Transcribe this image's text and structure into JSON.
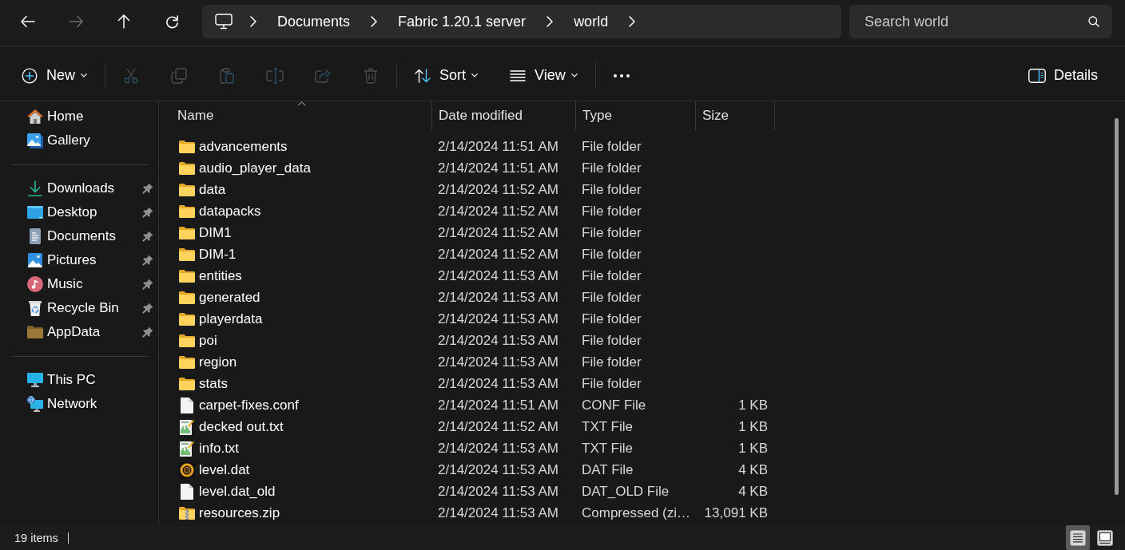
{
  "nav": [
    {
      "kind": "back",
      "disabled": false
    },
    {
      "kind": "forward",
      "disabled": true
    },
    {
      "kind": "up",
      "disabled": false
    },
    {
      "kind": "refresh",
      "disabled": false
    }
  ],
  "address_bar": {
    "crumbs": [
      "Documents",
      "Fabric 1.20.1 server",
      "world"
    ]
  },
  "search": {
    "placeholder": "Search world"
  },
  "toolbar": {
    "groups": [
      [
        {
          "kind": "new",
          "label": "New",
          "dropdown": true,
          "disabled": false
        }
      ],
      [
        {
          "kind": "cut",
          "dropdown": false,
          "disabled": true
        },
        {
          "kind": "copy",
          "dropdown": false,
          "disabled": true
        },
        {
          "kind": "paste",
          "dropdown": false,
          "disabled": true
        },
        {
          "kind": "rename",
          "dropdown": false,
          "disabled": true
        },
        {
          "kind": "share",
          "dropdown": false,
          "disabled": true
        },
        {
          "kind": "delete",
          "dropdown": false,
          "disabled": true
        }
      ],
      [
        {
          "kind": "sort",
          "label": "Sort",
          "dropdown": true,
          "disabled": false
        },
        {
          "kind": "view",
          "label": "View",
          "dropdown": true,
          "disabled": false
        }
      ],
      [
        {
          "kind": "more",
          "dropdown": false,
          "disabled": false
        }
      ]
    ],
    "details": {
      "label": "Details"
    }
  },
  "sidebar": {
    "sections": [
      {
        "items": [
          {
            "label": "Home",
            "kind": "home",
            "pinned": false
          },
          {
            "label": "Gallery",
            "kind": "gallery",
            "pinned": false
          }
        ]
      },
      {
        "items": [
          {
            "label": "Downloads",
            "kind": "downloads",
            "pinned": true
          },
          {
            "label": "Desktop",
            "kind": "desktop",
            "pinned": true
          },
          {
            "label": "Documents",
            "kind": "documents",
            "pinned": true
          },
          {
            "label": "Pictures",
            "kind": "pictures",
            "pinned": true
          },
          {
            "label": "Music",
            "kind": "music",
            "pinned": true
          },
          {
            "label": "Recycle Bin",
            "kind": "recycle-bin",
            "pinned": true
          },
          {
            "label": "AppData",
            "kind": "folder",
            "pinned": true
          }
        ]
      },
      {
        "items": [
          {
            "label": "This PC",
            "kind": "this-pc",
            "pinned": false
          },
          {
            "label": "Network",
            "kind": "network",
            "pinned": false
          }
        ]
      }
    ]
  },
  "table": {
    "columns": [
      {
        "label": "Name",
        "sorted": true
      },
      {
        "label": "Date modified",
        "sorted": false
      },
      {
        "label": "Type",
        "sorted": false
      },
      {
        "label": "Size",
        "sorted": false
      }
    ],
    "rows": [
      {
        "kind": "folder",
        "name": "advancements",
        "date": "2/14/2024 11:51 AM",
        "type": "File folder"
      },
      {
        "kind": "folder",
        "name": "audio_player_data",
        "date": "2/14/2024 11:51 AM",
        "type": "File folder"
      },
      {
        "kind": "folder",
        "name": "data",
        "date": "2/14/2024 11:52 AM",
        "type": "File folder"
      },
      {
        "kind": "folder",
        "name": "datapacks",
        "date": "2/14/2024 11:52 AM",
        "type": "File folder"
      },
      {
        "kind": "folder",
        "name": "DIM1",
        "date": "2/14/2024 11:52 AM",
        "type": "File folder"
      },
      {
        "kind": "folder",
        "name": "DIM-1",
        "date": "2/14/2024 11:52 AM",
        "type": "File folder"
      },
      {
        "kind": "folder",
        "name": "entities",
        "date": "2/14/2024 11:53 AM",
        "type": "File folder"
      },
      {
        "kind": "folder",
        "name": "generated",
        "date": "2/14/2024 11:53 AM",
        "type": "File folder"
      },
      {
        "kind": "folder",
        "name": "playerdata",
        "date": "2/14/2024 11:53 AM",
        "type": "File folder"
      },
      {
        "kind": "folder",
        "name": "poi",
        "date": "2/14/2024 11:53 AM",
        "type": "File folder"
      },
      {
        "kind": "folder",
        "name": "region",
        "date": "2/14/2024 11:53 AM",
        "type": "File folder"
      },
      {
        "kind": "folder",
        "name": "stats",
        "date": "2/14/2024 11:53 AM",
        "type": "File folder"
      },
      {
        "kind": "file",
        "name": "carpet-fixes.conf",
        "date": "2/14/2024 11:51 AM",
        "type": "CONF File",
        "size": "1 KB"
      },
      {
        "kind": "text",
        "name": "decked out.txt",
        "date": "2/14/2024 11:52 AM",
        "type": "TXT File",
        "size": "1 KB"
      },
      {
        "kind": "text",
        "name": "info.txt",
        "date": "2/14/2024 11:53 AM",
        "type": "TXT File",
        "size": "1 KB"
      },
      {
        "kind": "app",
        "name": "level.dat",
        "date": "2/14/2024 11:53 AM",
        "type": "DAT File",
        "size": "4 KB"
      },
      {
        "kind": "file",
        "name": "level.dat_old",
        "date": "2/14/2024 11:53 AM",
        "type": "DAT_OLD File",
        "size": "4 KB"
      },
      {
        "kind": "zip",
        "name": "resources.zip",
        "date": "2/14/2024 11:53 AM",
        "type": "Compressed (zi…",
        "size": "13,091 KB"
      }
    ]
  },
  "status_bar": {
    "item_count": "19 items",
    "view_modes": [
      {
        "kind": "details",
        "selected": true
      },
      {
        "kind": "large-icons",
        "selected": false
      }
    ]
  }
}
